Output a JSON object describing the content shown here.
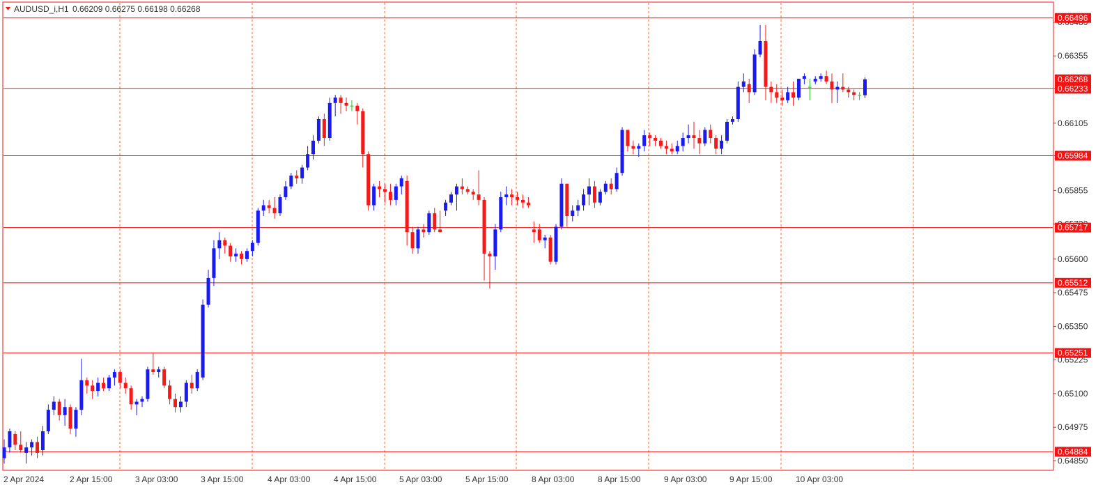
{
  "header": {
    "symbol": "AUDUSD_i,H1",
    "ohlc": "0.66209 0.66275 0.66198 0.66268"
  },
  "colors": {
    "bull": "#1a1af5",
    "bear": "#f51a1a",
    "doji": "#22c122",
    "level_line": "#f01515",
    "grid": "#f06d3b",
    "axis_text": "#333333"
  },
  "chart_data": {
    "type": "candlestick",
    "symbol": "AUDUSD_i",
    "timeframe": "H1",
    "ylim": [
      0.64815,
      0.66555
    ],
    "y_ticks": [
      0.6485,
      0.64975,
      0.651,
      0.65225,
      0.6535,
      0.65475,
      0.656,
      0.6573,
      0.65855,
      0.65984,
      0.66105,
      0.66233,
      0.66355,
      0.6648
    ],
    "x_labels": [
      "2 Apr 2024",
      "2 Apr 15:00",
      "3 Apr 03:00",
      "3 Apr 15:00",
      "4 Apr 03:00",
      "4 Apr 15:00",
      "5 Apr 03:00",
      "5 Apr 15:00",
      "8 Apr 03:00",
      "8 Apr 15:00",
      "9 Apr 03:00",
      "9 Apr 15:00",
      "10 Apr 03:00"
    ],
    "levels": [
      0.66496,
      0.66233,
      0.65984,
      0.65717,
      0.65512,
      0.65251,
      0.64884
    ],
    "current_price": 0.66268,
    "candles": [
      [
        0.6486,
        0.6493,
        0.6484,
        0.649
      ],
      [
        0.649,
        0.6497,
        0.6488,
        0.6496
      ],
      [
        0.6495,
        0.6496,
        0.6489,
        0.6491
      ],
      [
        0.6491,
        0.6496,
        0.6488,
        0.6489
      ],
      [
        0.6488,
        0.6492,
        0.6484,
        0.649
      ],
      [
        0.649,
        0.6493,
        0.6487,
        0.6492
      ],
      [
        0.6492,
        0.6494,
        0.6486,
        0.6488
      ],
      [
        0.6489,
        0.6498,
        0.6487,
        0.6496
      ],
      [
        0.6496,
        0.6506,
        0.6495,
        0.6504
      ],
      [
        0.6504,
        0.6509,
        0.6502,
        0.6507
      ],
      [
        0.6507,
        0.6508,
        0.65,
        0.6502
      ],
      [
        0.6502,
        0.6508,
        0.6498,
        0.6505
      ],
      [
        0.6505,
        0.6506,
        0.6495,
        0.6497
      ],
      [
        0.6497,
        0.6505,
        0.6494,
        0.6504
      ],
      [
        0.6504,
        0.6523,
        0.6502,
        0.6515
      ],
      [
        0.6515,
        0.6516,
        0.651,
        0.6513
      ],
      [
        0.6513,
        0.6515,
        0.6508,
        0.6511
      ],
      [
        0.6511,
        0.6516,
        0.6509,
        0.6514
      ],
      [
        0.6514,
        0.6516,
        0.6511,
        0.6512
      ],
      [
        0.6512,
        0.6517,
        0.6511,
        0.6516
      ],
      [
        0.6516,
        0.6519,
        0.6513,
        0.6518
      ],
      [
        0.6518,
        0.6519,
        0.6512,
        0.6514
      ],
      [
        0.6514,
        0.6516,
        0.651,
        0.6512
      ],
      [
        0.6512,
        0.6513,
        0.6504,
        0.6506
      ],
      [
        0.6506,
        0.6508,
        0.6502,
        0.6507
      ],
      [
        0.6507,
        0.6509,
        0.6505,
        0.6508
      ],
      [
        0.6508,
        0.652,
        0.6507,
        0.6519
      ],
      [
        0.6519,
        0.6525,
        0.6517,
        0.6518
      ],
      [
        0.6518,
        0.652,
        0.6516,
        0.6519
      ],
      [
        0.6519,
        0.652,
        0.6512,
        0.6513
      ],
      [
        0.6513,
        0.6515,
        0.6506,
        0.6508
      ],
      [
        0.6508,
        0.651,
        0.6503,
        0.6505
      ],
      [
        0.6505,
        0.6509,
        0.6503,
        0.6507
      ],
      [
        0.6507,
        0.6515,
        0.6505,
        0.6514
      ],
      [
        0.6514,
        0.6517,
        0.651,
        0.6512
      ],
      [
        0.6512,
        0.6519,
        0.6511,
        0.6518
      ],
      [
        0.6516,
        0.6545,
        0.6515,
        0.6543
      ],
      [
        0.6543,
        0.6556,
        0.6542,
        0.6553
      ],
      [
        0.6553,
        0.6567,
        0.655,
        0.6564
      ],
      [
        0.6564,
        0.657,
        0.656,
        0.6567
      ],
      [
        0.6567,
        0.6568,
        0.6562,
        0.6565
      ],
      [
        0.6565,
        0.6566,
        0.6559,
        0.6561
      ],
      [
        0.6561,
        0.6564,
        0.6559,
        0.6562
      ],
      [
        0.6562,
        0.6563,
        0.6558,
        0.656
      ],
      [
        0.656,
        0.6564,
        0.6559,
        0.6563
      ],
      [
        0.6563,
        0.6567,
        0.6561,
        0.6566
      ],
      [
        0.6566,
        0.6579,
        0.6565,
        0.6578
      ],
      [
        0.6578,
        0.6582,
        0.6576,
        0.658
      ],
      [
        0.658,
        0.6582,
        0.6577,
        0.6579
      ],
      [
        0.6579,
        0.6583,
        0.6575,
        0.6577
      ],
      [
        0.6577,
        0.6584,
        0.6576,
        0.6583
      ],
      [
        0.6583,
        0.6589,
        0.6582,
        0.6587
      ],
      [
        0.6587,
        0.6592,
        0.6586,
        0.6591
      ],
      [
        0.6591,
        0.6593,
        0.6588,
        0.659
      ],
      [
        0.659,
        0.6595,
        0.6588,
        0.6594
      ],
      [
        0.6594,
        0.6602,
        0.6593,
        0.6599
      ],
      [
        0.6599,
        0.6606,
        0.6597,
        0.6604
      ],
      [
        0.6604,
        0.6613,
        0.6603,
        0.6612
      ],
      [
        0.6612,
        0.6614,
        0.6602,
        0.6605
      ],
      [
        0.6605,
        0.662,
        0.6604,
        0.6618
      ],
      [
        0.6618,
        0.6621,
        0.6613,
        0.662
      ],
      [
        0.662,
        0.6621,
        0.6614,
        0.6618
      ],
      [
        0.6618,
        0.662,
        0.6615,
        0.6617
      ],
      [
        0.6617,
        0.6619,
        0.6615,
        0.6617
      ],
      [
        0.6617,
        0.6618,
        0.661,
        0.6615
      ],
      [
        0.6615,
        0.6616,
        0.6594,
        0.6599
      ],
      [
        0.6599,
        0.66,
        0.6578,
        0.658
      ],
      [
        0.658,
        0.6588,
        0.6578,
        0.6587
      ],
      [
        0.6587,
        0.6589,
        0.6583,
        0.6586
      ],
      [
        0.6586,
        0.6588,
        0.6581,
        0.6585
      ],
      [
        0.6585,
        0.6588,
        0.658,
        0.6582
      ],
      [
        0.6582,
        0.6588,
        0.658,
        0.6587
      ],
      [
        0.6587,
        0.6591,
        0.6584,
        0.659
      ],
      [
        0.6589,
        0.6591,
        0.6565,
        0.657
      ],
      [
        0.657,
        0.6572,
        0.6562,
        0.6564
      ],
      [
        0.6564,
        0.6572,
        0.6562,
        0.6571
      ],
      [
        0.6571,
        0.6573,
        0.6568,
        0.657
      ],
      [
        0.657,
        0.6578,
        0.6569,
        0.6577
      ],
      [
        0.6577,
        0.6579,
        0.657,
        0.6571
      ],
      [
        0.6571,
        0.6578,
        0.657,
        0.657
      ],
      [
        0.6578,
        0.6582,
        0.6576,
        0.6581
      ],
      [
        0.6581,
        0.6585,
        0.658,
        0.6584
      ],
      [
        0.6584,
        0.6588,
        0.6578,
        0.6587
      ],
      [
        0.6587,
        0.659,
        0.6584,
        0.6586
      ],
      [
        0.6586,
        0.6587,
        0.6584,
        0.6585
      ],
      [
        0.6585,
        0.6586,
        0.6582,
        0.6584
      ],
      [
        0.6584,
        0.6593,
        0.658,
        0.6582
      ],
      [
        0.6582,
        0.6583,
        0.6552,
        0.6562
      ],
      [
        0.6562,
        0.6563,
        0.6549,
        0.6561
      ],
      [
        0.6561,
        0.6573,
        0.6556,
        0.6571
      ],
      [
        0.6571,
        0.6585,
        0.657,
        0.6583
      ],
      [
        0.6583,
        0.6587,
        0.658,
        0.6584
      ],
      [
        0.6584,
        0.6586,
        0.658,
        0.6583
      ],
      [
        0.6583,
        0.6585,
        0.658,
        0.6582
      ],
      [
        0.6582,
        0.6584,
        0.6579,
        0.6581
      ],
      [
        0.6581,
        0.6583,
        0.6579,
        0.658
      ],
      [
        0.6571,
        0.6574,
        0.6566,
        0.657
      ],
      [
        0.6571,
        0.6573,
        0.6566,
        0.6567
      ],
      [
        0.6567,
        0.6569,
        0.6564,
        0.6568
      ],
      [
        0.6568,
        0.6569,
        0.6558,
        0.6559
      ],
      [
        0.6559,
        0.6573,
        0.6558,
        0.6572
      ],
      [
        0.6572,
        0.659,
        0.6571,
        0.6588
      ],
      [
        0.6588,
        0.6588,
        0.6572,
        0.6576
      ],
      [
        0.6576,
        0.658,
        0.6574,
        0.6578
      ],
      [
        0.6578,
        0.6582,
        0.6576,
        0.658
      ],
      [
        0.658,
        0.6586,
        0.6578,
        0.6584
      ],
      [
        0.6584,
        0.659,
        0.658,
        0.6587
      ],
      [
        0.6587,
        0.6589,
        0.6579,
        0.6581
      ],
      [
        0.6581,
        0.6586,
        0.658,
        0.6585
      ],
      [
        0.6585,
        0.6589,
        0.6584,
        0.6588
      ],
      [
        0.6588,
        0.659,
        0.6584,
        0.6586
      ],
      [
        0.6586,
        0.6594,
        0.6585,
        0.6592
      ],
      [
        0.6592,
        0.6609,
        0.6591,
        0.6608
      ],
      [
        0.6608,
        0.6608,
        0.66,
        0.6602
      ],
      [
        0.6602,
        0.6604,
        0.6599,
        0.6601
      ],
      [
        0.6601,
        0.6603,
        0.6598,
        0.6602
      ],
      [
        0.6602,
        0.6608,
        0.66,
        0.6606
      ],
      [
        0.6606,
        0.6607,
        0.6602,
        0.6605
      ],
      [
        0.6605,
        0.6606,
        0.6602,
        0.6604
      ],
      [
        0.6604,
        0.6605,
        0.6601,
        0.6602
      ],
      [
        0.6602,
        0.6604,
        0.6599,
        0.6601
      ],
      [
        0.6601,
        0.6603,
        0.6599,
        0.66
      ],
      [
        0.66,
        0.6604,
        0.6599,
        0.6602
      ],
      [
        0.6602,
        0.6607,
        0.66,
        0.6605
      ],
      [
        0.6605,
        0.661,
        0.6603,
        0.6606
      ],
      [
        0.6606,
        0.6611,
        0.6601,
        0.6605
      ],
      [
        0.6605,
        0.6608,
        0.6599,
        0.6603
      ],
      [
        0.6603,
        0.6609,
        0.6602,
        0.6608
      ],
      [
        0.6608,
        0.661,
        0.6603,
        0.6605
      ],
      [
        0.6605,
        0.6606,
        0.6599,
        0.6601
      ],
      [
        0.6601,
        0.6606,
        0.6599,
        0.6604
      ],
      [
        0.6604,
        0.6612,
        0.6603,
        0.6611
      ],
      [
        0.6611,
        0.6613,
        0.661,
        0.6612
      ],
      [
        0.6612,
        0.6626,
        0.6611,
        0.6624
      ],
      [
        0.6624,
        0.6629,
        0.6622,
        0.6626
      ],
      [
        0.6625,
        0.6627,
        0.6618,
        0.6622
      ],
      [
        0.6622,
        0.6638,
        0.6621,
        0.6636
      ],
      [
        0.6636,
        0.6647,
        0.6635,
        0.6641
      ],
      [
        0.6641,
        0.6647,
        0.6619,
        0.6624
      ],
      [
        0.6624,
        0.6626,
        0.6618,
        0.6622
      ],
      [
        0.6622,
        0.6625,
        0.6618,
        0.662
      ],
      [
        0.662,
        0.6623,
        0.6617,
        0.6619
      ],
      [
        0.6619,
        0.6624,
        0.6618,
        0.6622
      ],
      [
        0.6622,
        0.6626,
        0.6617,
        0.662
      ],
      [
        0.662,
        0.6627,
        0.6619,
        0.6627
      ],
      [
        0.6627,
        0.6629,
        0.6625,
        0.6628
      ],
      [
        0.6624,
        0.6627,
        0.6619,
        0.6624
      ],
      [
        0.6626,
        0.6628,
        0.6625,
        0.6627
      ],
      [
        0.6627,
        0.6629,
        0.6626,
        0.6628
      ],
      [
        0.6628,
        0.663,
        0.6625,
        0.6626
      ],
      [
        0.6626,
        0.6629,
        0.6618,
        0.6623
      ],
      [
        0.6623,
        0.6626,
        0.6618,
        0.6624
      ],
      [
        0.6624,
        0.6629,
        0.6622,
        0.6623
      ],
      [
        0.6623,
        0.6624,
        0.662,
        0.6622
      ],
      [
        0.6622,
        0.6623,
        0.6619,
        0.6621
      ],
      [
        0.6621,
        0.6622,
        0.6619,
        0.6621
      ],
      [
        0.66209,
        0.66275,
        0.66198,
        0.66268
      ]
    ]
  }
}
